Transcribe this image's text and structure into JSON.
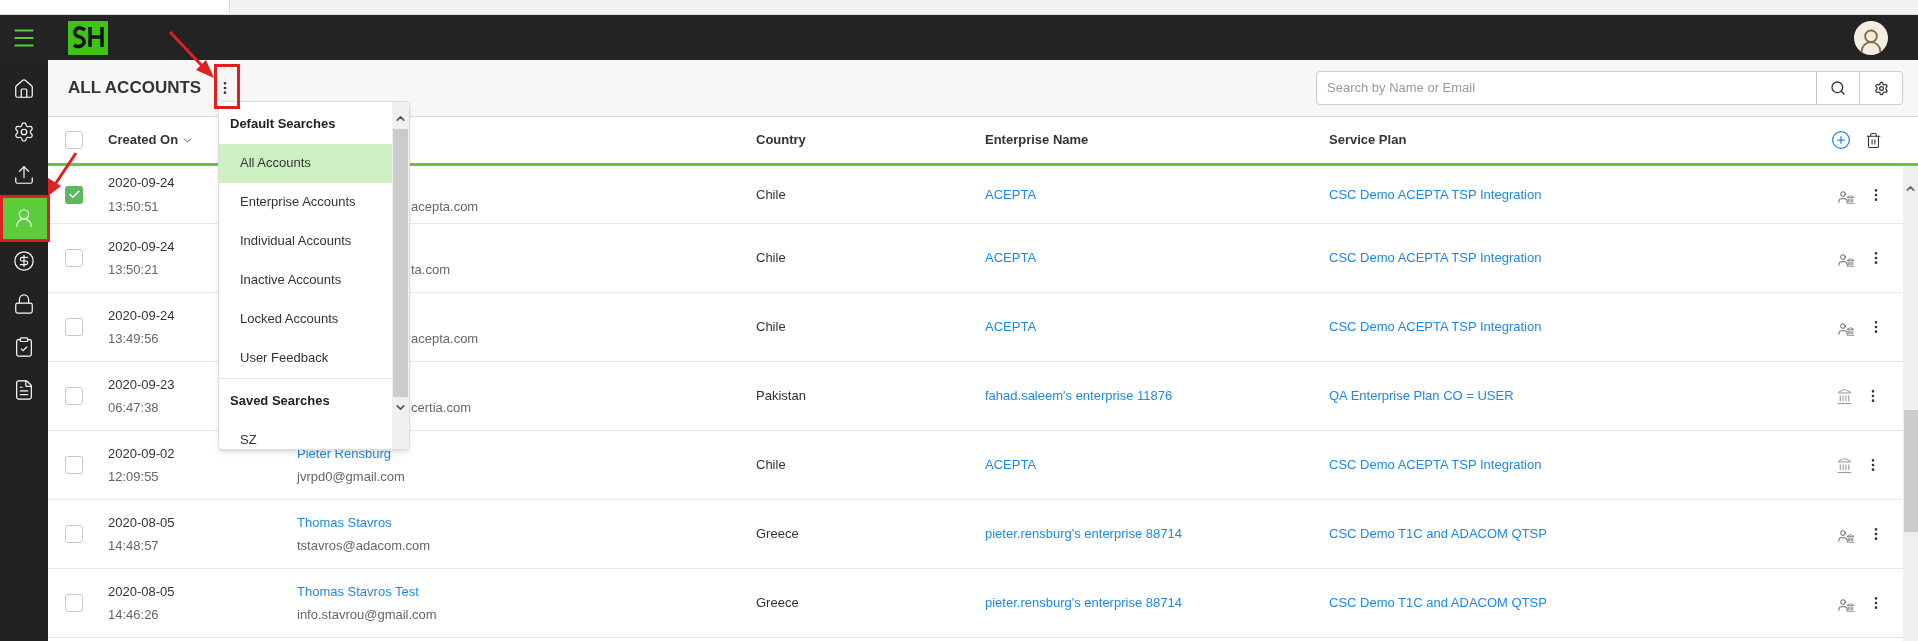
{
  "sidebar": {
    "items": [
      {
        "kind": "home",
        "selected": false
      },
      {
        "kind": "settings",
        "selected": false
      },
      {
        "kind": "upload",
        "selected": false
      },
      {
        "kind": "user",
        "selected": true
      },
      {
        "kind": "dollar",
        "selected": false
      },
      {
        "kind": "lock",
        "selected": false
      },
      {
        "kind": "clipboard",
        "selected": false
      },
      {
        "kind": "document",
        "selected": false
      }
    ]
  },
  "header": {
    "title": "ALL ACCOUNTS",
    "search": {
      "placeholder": "Search by Name or Email"
    }
  },
  "search_menu": {
    "sections": [
      {
        "title": "Default Searches",
        "items": [
          {
            "label": "All Accounts",
            "selected": true
          },
          {
            "label": "Enterprise Accounts",
            "selected": false
          },
          {
            "label": "Individual Accounts",
            "selected": false
          },
          {
            "label": "Inactive Accounts",
            "selected": false
          },
          {
            "label": "Locked Accounts",
            "selected": false
          },
          {
            "label": "User Feedback",
            "selected": false
          }
        ]
      },
      {
        "title": "Saved Searches",
        "items": [
          {
            "label": "SZ",
            "selected": false
          }
        ]
      }
    ]
  },
  "table": {
    "select_all": {
      "checked": false
    },
    "columns": [
      {
        "label": "Created On",
        "sorted": true
      },
      {
        "label": "Country",
        "sorted": false
      },
      {
        "label": "Enterprise Name",
        "sorted": false
      },
      {
        "label": "Service Plan",
        "sorted": false
      }
    ],
    "rows": [
      {
        "selected": true,
        "date": "2020-09-24",
        "time": "13:50:51",
        "email": "acepta.com",
        "country": "Chile",
        "enterprise": "ACEPTA",
        "service_plan": "CSC Demo ACEPTA TSP Integration",
        "kind": "user-bank"
      },
      {
        "selected": false,
        "date": "2020-09-24",
        "time": "13:50:21",
        "email": "ta.com",
        "country": "Chile",
        "enterprise": "ACEPTA",
        "service_plan": "CSC Demo ACEPTA TSP Integration",
        "kind": "user-bank"
      },
      {
        "selected": false,
        "date": "2020-09-24",
        "time": "13:49:56",
        "email": "acepta.com",
        "country": "Chile",
        "enterprise": "ACEPTA",
        "service_plan": "CSC Demo ACEPTA TSP Integration",
        "kind": "user-bank"
      },
      {
        "selected": false,
        "date": "2020-09-23",
        "time": "06:47:38",
        "email": "certia.com",
        "country": "Pakistan",
        "enterprise": "fahad.saleem's enterprise 11876",
        "service_plan": "QA Enterprise Plan CO = USER",
        "kind": "bank"
      },
      {
        "selected": false,
        "date": "2020-09-02",
        "time": "12:09:55",
        "name": "Pieter Rensburg",
        "email": "jvrpd0@gmail.com",
        "country": "Chile",
        "enterprise": "ACEPTA",
        "service_plan": "CSC Demo ACEPTA TSP Integration",
        "kind": "bank"
      },
      {
        "selected": false,
        "date": "2020-08-05",
        "time": "14:48:57",
        "name": "Thomas Stavros",
        "email": "tstavros@adacom.com",
        "country": "Greece",
        "enterprise": "pieter.rensburg's enterprise 88714",
        "service_plan": "CSC Demo T1C and ADACOM QTSP",
        "kind": "user-bank"
      },
      {
        "selected": false,
        "date": "2020-08-05",
        "time": "14:46:26",
        "name": "Thomas Stavros Test",
        "email": "info.stavrou@gmail.com",
        "country": "Greece",
        "enterprise": "pieter.rensburg's enterprise 88714",
        "service_plan": "CSC Demo T1C and ADACOM QTSP",
        "kind": "user-bank"
      }
    ]
  }
}
